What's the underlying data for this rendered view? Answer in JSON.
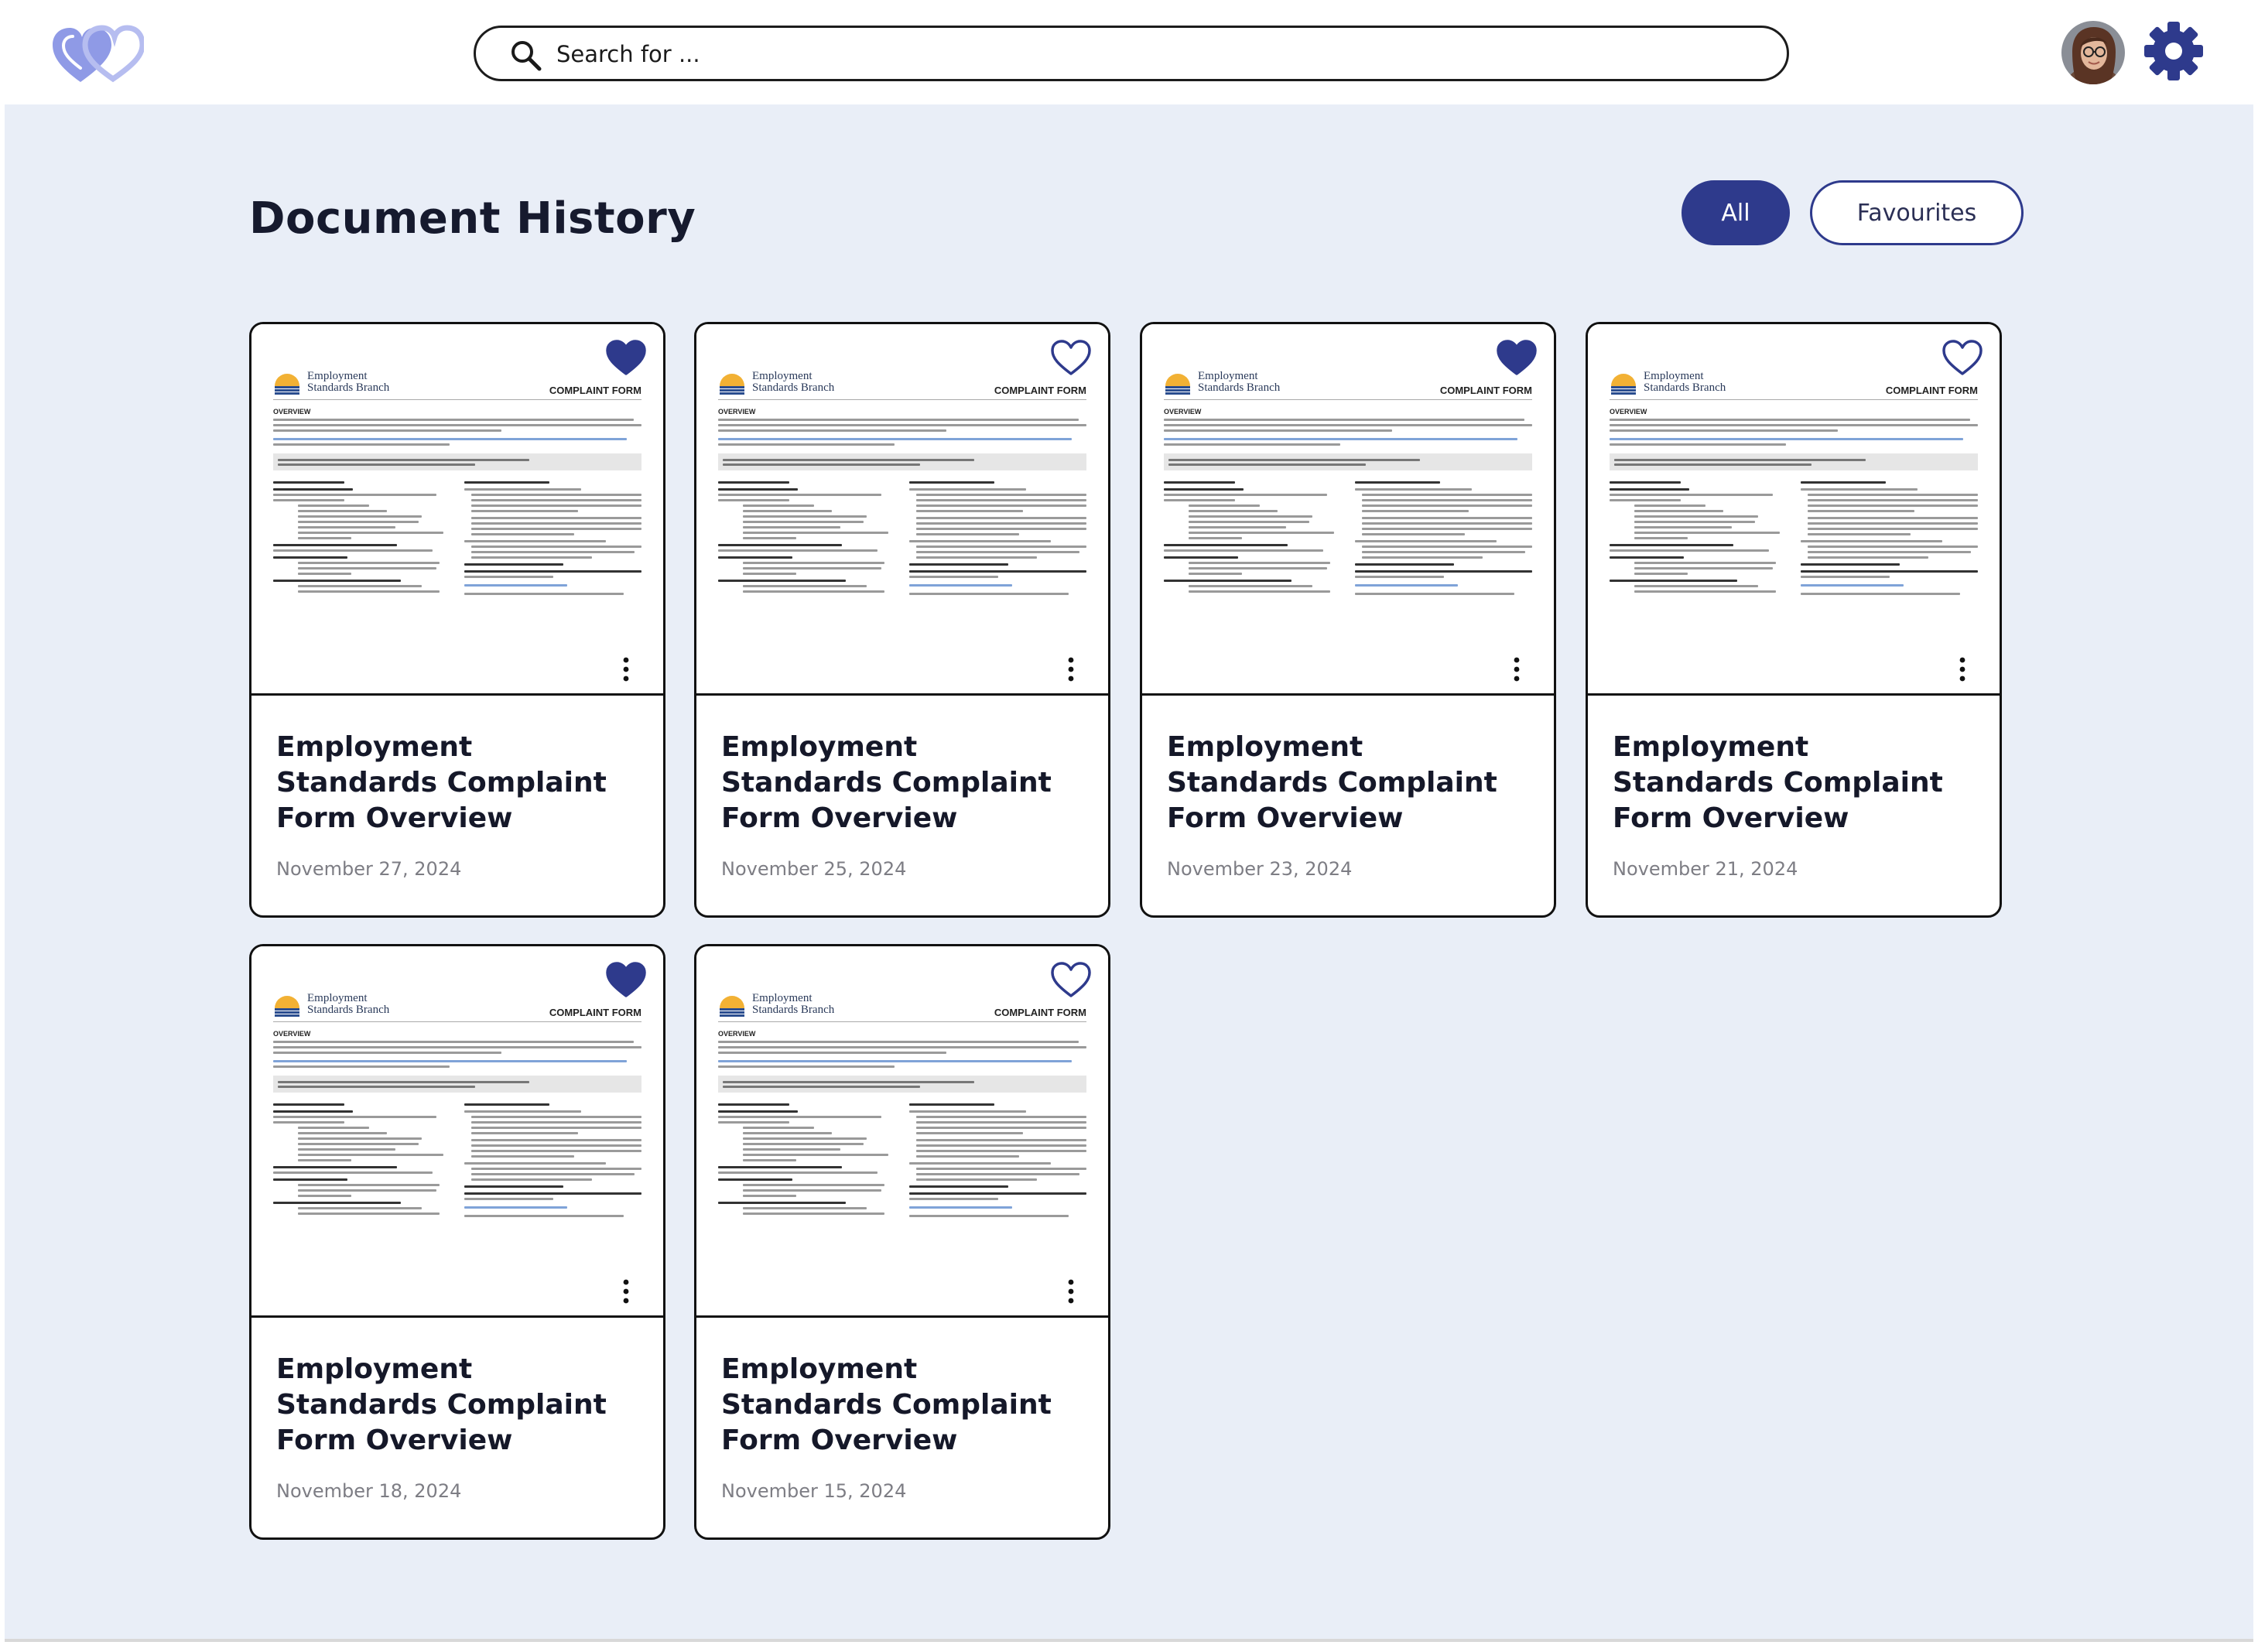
{
  "header": {
    "logo_icon": "linked-hearts-logo-icon",
    "search": {
      "placeholder": "Search for ...",
      "value": ""
    },
    "avatar_icon": "user-avatar",
    "settings_icon": "gear-icon"
  },
  "main": {
    "title": "Document History",
    "filters": [
      {
        "label": "All",
        "active": true
      },
      {
        "label": "Favourites",
        "active": false
      }
    ]
  },
  "thumbnail": {
    "org_line1": "Employment",
    "org_line2": "Standards Branch",
    "form_label": "COMPLAINT FORM",
    "overview_label": "OVERVIEW"
  },
  "documents": [
    {
      "title": "Employment Standards Complaint Form Overview",
      "date": "November 27, 2024",
      "favourite": true
    },
    {
      "title": "Employment Standards Complaint Form Overview",
      "date": "November 25, 2024",
      "favourite": false
    },
    {
      "title": "Employment Standards Complaint Form Overview",
      "date": "November 23, 2024",
      "favourite": true
    },
    {
      "title": "Employment Standards Complaint Form Overview",
      "date": "November 21, 2024",
      "favourite": false
    },
    {
      "title": "Employment Standards Complaint Form Overview",
      "date": "November 18, 2024",
      "favourite": true
    },
    {
      "title": "Employment Standards Complaint Form Overview",
      "date": "November 15, 2024",
      "favourite": false
    }
  ],
  "colors": {
    "accent": "#2e3a8c",
    "background": "#e9eef7",
    "heart": "#2e3a8c"
  }
}
